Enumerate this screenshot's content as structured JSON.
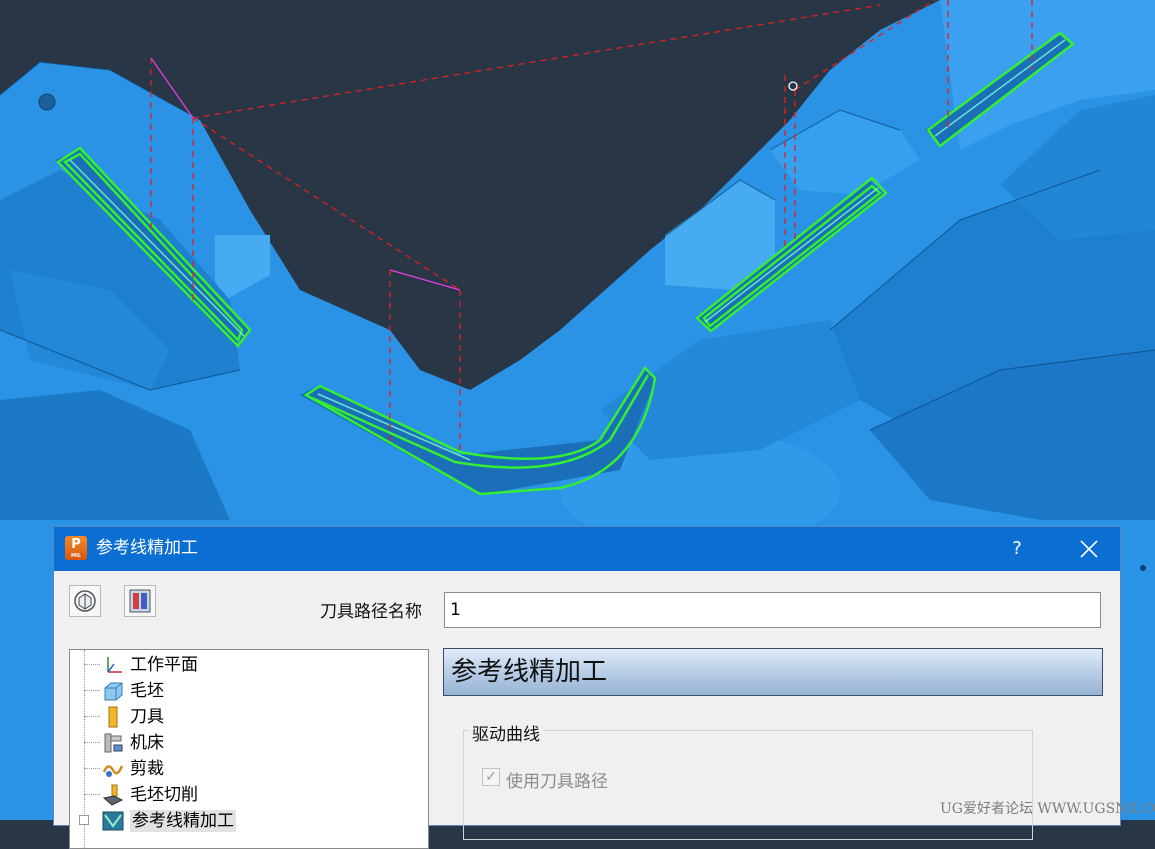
{
  "dialog": {
    "title": "参考线精加工",
    "help_label": "?",
    "app_icon": {
      "letter": "P",
      "sub": "MIL",
      "color": "#f07a1e"
    },
    "toolpath_name_label": "刀具路径名称",
    "toolpath_name_value": "1",
    "tree": [
      {
        "label": "工作平面",
        "icon": "workplane-icon"
      },
      {
        "label": "毛坯",
        "icon": "block-icon"
      },
      {
        "label": "刀具",
        "icon": "tool-icon"
      },
      {
        "label": "机床",
        "icon": "machine-icon"
      },
      {
        "label": "剪裁",
        "icon": "limit-icon"
      },
      {
        "label": "毛坯切削",
        "icon": "stock-cut-icon"
      },
      {
        "label": "参考线精加工",
        "icon": "pattern-finishing-icon"
      }
    ],
    "page_title": "参考线精加工",
    "drive_curve_group": "驱动曲线",
    "use_toolpath_label": "使用刀具路径",
    "use_toolpath_checked": true
  },
  "watermark": "UG爱好者论坛 WWW.UGSNX.COM",
  "colors": {
    "titlebar": "#0a6ed2",
    "model": "#2a93e6",
    "toolpath": "#33ee33",
    "background": "#283645"
  }
}
